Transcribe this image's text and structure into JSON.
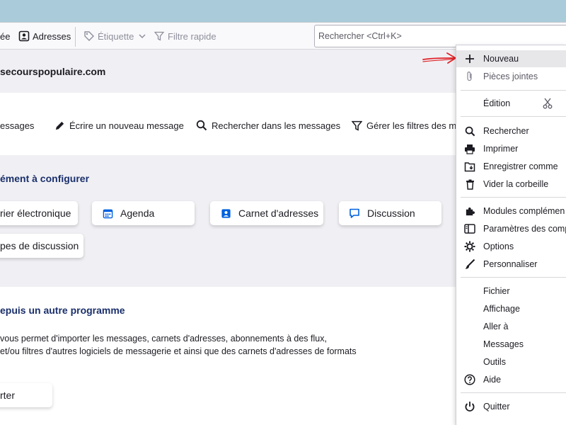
{
  "toolbar": {
    "left_partial": "ée",
    "addresses": "Adresses",
    "tag": "Étiquette",
    "quick_filter": "Filtre rapide",
    "search_placeholder": "Rechercher <Ctrl+K>"
  },
  "account": {
    "domain": "secourspopulaire.com"
  },
  "actions": [
    {
      "label": "essages",
      "icon": "mail-icon"
    },
    {
      "label": "Écrire un nouveau message",
      "icon": "pencil-icon"
    },
    {
      "label": "Rechercher dans les messages",
      "icon": "search-icon"
    },
    {
      "label": "Gérer les filtres des mes",
      "icon": "filter-icon"
    }
  ],
  "setup": {
    "title": "ément à configurer",
    "cards": [
      {
        "label": "rier électronique",
        "icon": "mail-icon"
      },
      {
        "label": "Agenda",
        "icon": "calendar-icon"
      },
      {
        "label": "Carnet d'adresses",
        "icon": "address-book-icon"
      },
      {
        "label": "Discussion",
        "icon": "chat-icon"
      },
      {
        "label": "pes de discussion",
        "icon": "newsgroup-icon"
      }
    ]
  },
  "import": {
    "title": "epuis un autre programme",
    "lines": [
      "vous permet d'importer les messages, carnets d'adresses, abonnements à des flux,",
      "et/ou filtres d'autres logiciels de messagerie et ainsi que des carnets d'adresses de formats"
    ],
    "button": "rter"
  },
  "menu": {
    "new": "Nouveau",
    "attachments": "Pièces jointes",
    "edit": "Édition",
    "find": "Rechercher",
    "print": "Imprimer",
    "save_as": "Enregistrer comme",
    "empty_trash": "Vider la corbeille",
    "addons": "Modules complémen",
    "account_settings": "Paramètres des comp",
    "options": "Options",
    "customize": "Personnaliser",
    "file": "Fichier",
    "view": "Affichage",
    "go": "Aller à",
    "messages": "Messages",
    "tools": "Outils",
    "help": "Aide",
    "quit": "Quitter"
  },
  "colors": {
    "accent": "#0060df",
    "section_title": "#1a2f6b",
    "annotation_arrow": "#e0242a",
    "titlebar": "#a9cbda"
  }
}
